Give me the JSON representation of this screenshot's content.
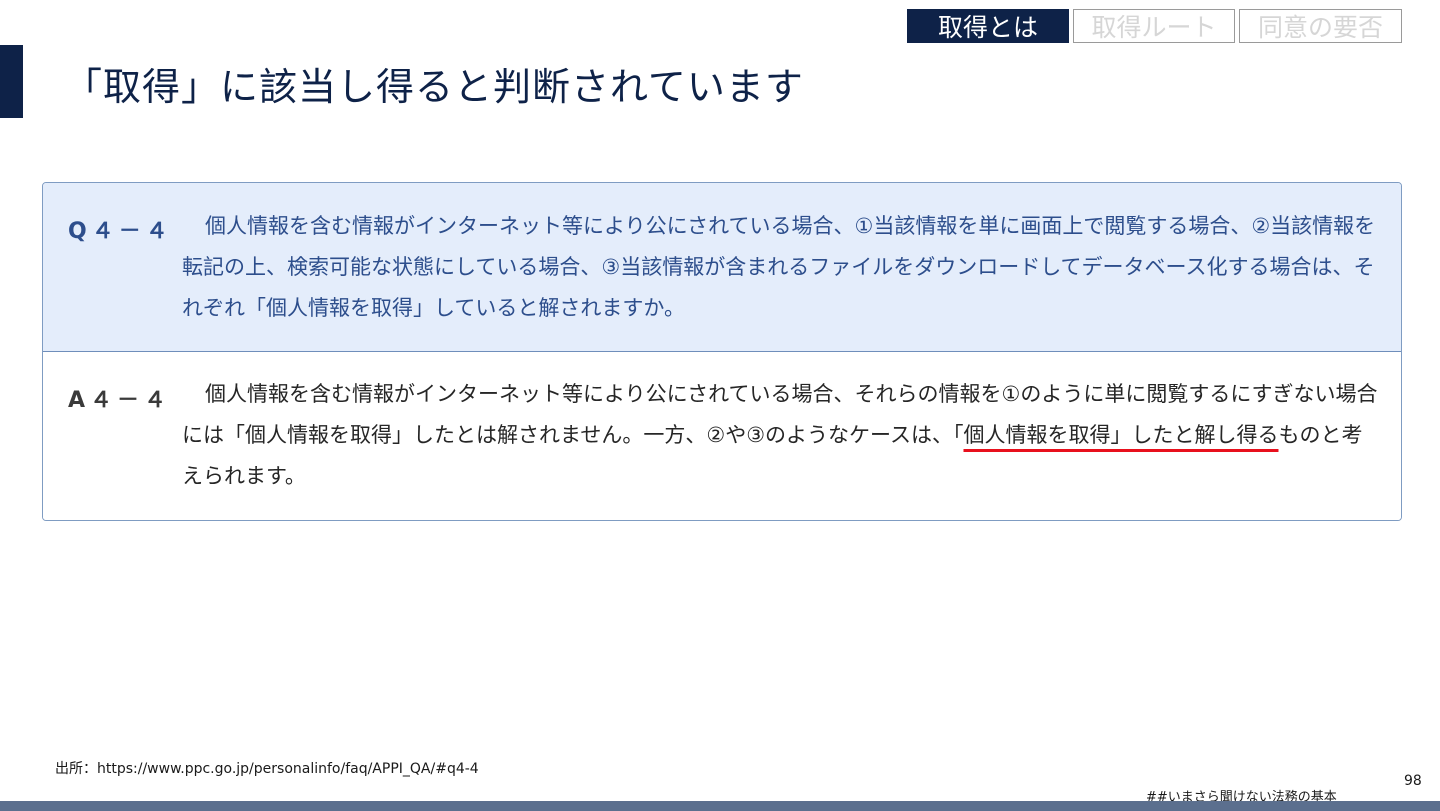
{
  "nav": {
    "tabs": [
      {
        "label": "取得とは",
        "active": true
      },
      {
        "label": "取得ルート",
        "active": false
      },
      {
        "label": "同意の要否",
        "active": false
      }
    ]
  },
  "page_title": "「取得」に該当し得ると判断されています",
  "qa": {
    "question": {
      "label": "Q４－４",
      "text": "個人情報を含む情報がインターネット等により公にされている場合、①当該情報を単に画面上で閲覧する場合、②当該情報を転記の上、検索可能な状態にしている場合、③当該情報が含まれるファイルをダウンロードしてデータベース化する場合は、それぞれ「個人情報を取得」していると解されますか。"
    },
    "answer": {
      "label": "A４－４",
      "text_before": "個人情報を含む情報がインターネット等により公にされている場合、それらの情報を①のように単に閲覧するにすぎない場合には「個人情報を取得」したとは解されません。一方、②や③のようなケースは、「",
      "text_underlined": "個人情報を取得」したと解し得る",
      "text_after": "ものと考えられます。"
    }
  },
  "source": "出所：https://www.ppc.go.jp/personalinfo/faq/APPI_QA/#q4-4",
  "hashtag": "##いまさら聞けない法務の基本",
  "page_number": "98",
  "colors": {
    "navy": "#0e2248",
    "question_bg": "#e4edfb",
    "question_text": "#2d4e8c",
    "underline": "#e8101d"
  }
}
